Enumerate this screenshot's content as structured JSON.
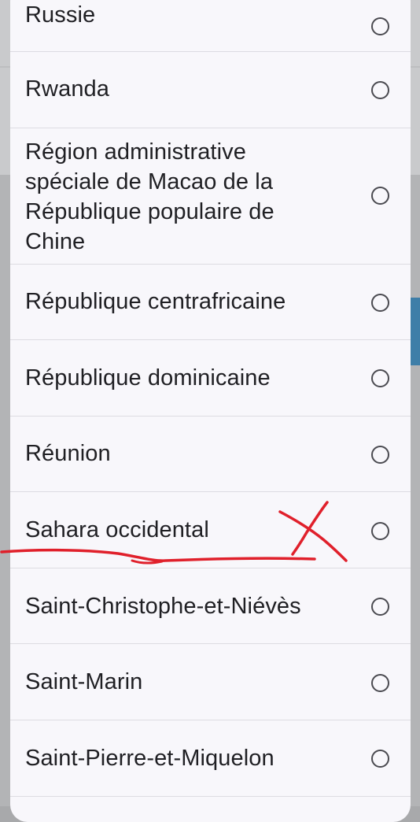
{
  "countries": [
    {
      "label": "Russie",
      "selected": false
    },
    {
      "label": "Rwanda",
      "selected": false
    },
    {
      "label": "Région administrative spéciale de Macao de la République populaire de Chine",
      "selected": false
    },
    {
      "label": "République centrafricaine",
      "selected": false
    },
    {
      "label": "République dominicaine",
      "selected": false
    },
    {
      "label": "Réunion",
      "selected": false
    },
    {
      "label": "Sahara occidental",
      "selected": false
    },
    {
      "label": "Saint-Christophe-et-Niévès",
      "selected": false
    },
    {
      "label": "Saint-Marin",
      "selected": false
    },
    {
      "label": "Saint-Pierre-et-Miquelon",
      "selected": false
    }
  ],
  "colors": {
    "sheet_background": "#f8f7fb",
    "text": "#1f1f23",
    "radio_border": "#4a4a50",
    "divider": "#dddce2",
    "annotation": "#e0202b",
    "accent": "#3e7ea8"
  },
  "annotation": {
    "marked_item": "Sahara occidental",
    "marks": [
      "underline",
      "cross"
    ]
  }
}
